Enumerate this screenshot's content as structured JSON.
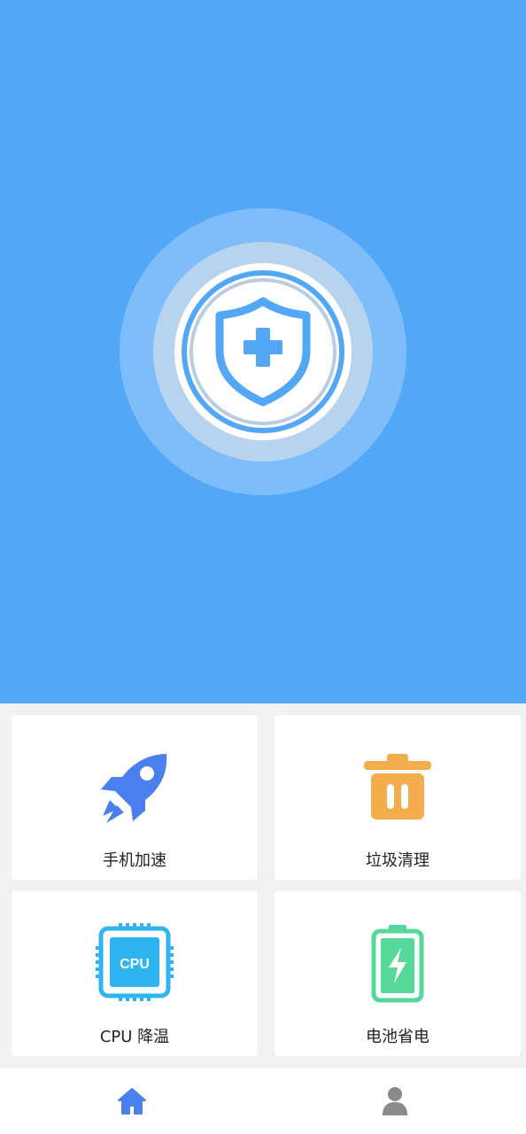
{
  "hero": {
    "icon": "shield-plus-icon",
    "colors": {
      "background": "#53a7f7",
      "accent": "#53a7f7"
    }
  },
  "features": [
    {
      "label": "手机加速",
      "icon": "rocket-icon",
      "color": "#4a7ff0"
    },
    {
      "label": "垃圾清理",
      "icon": "trash-icon",
      "color": "#f3ad4b"
    },
    {
      "label": "CPU 降温",
      "icon": "cpu-chip-icon",
      "color": "#2fb4f2",
      "chip_text": "CPU"
    },
    {
      "label": "电池省电",
      "icon": "battery-charging-icon",
      "color": "#55d89a"
    }
  ],
  "nav": {
    "items": [
      {
        "icon": "home-icon",
        "active": true,
        "color": "#4a7ff0"
      },
      {
        "icon": "user-icon",
        "active": false,
        "color": "#8a8a8a"
      }
    ]
  }
}
